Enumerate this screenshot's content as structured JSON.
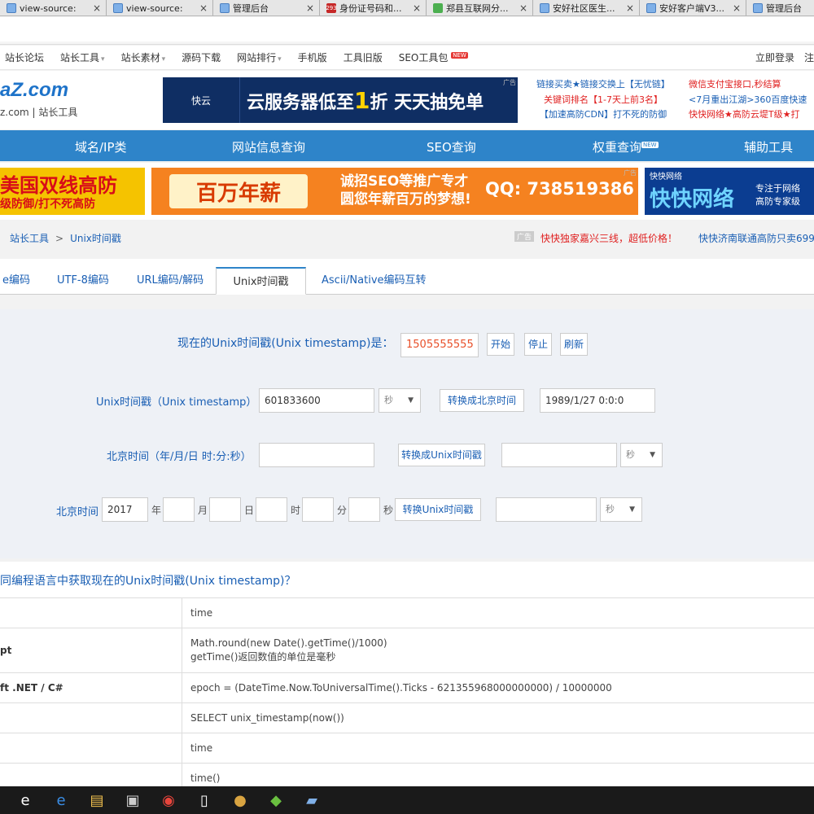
{
  "browser_tabs": [
    {
      "title": "view-source:",
      "favicon": "doc"
    },
    {
      "title": "view-source:",
      "favicon": "doc"
    },
    {
      "title": "管理后台",
      "favicon": "doc"
    },
    {
      "title": "身份证号码和...",
      "favicon": "red",
      "badge": "293"
    },
    {
      "title": "郑县互联网分...",
      "favicon": "grn"
    },
    {
      "title": "安好社区医生...",
      "favicon": "doc"
    },
    {
      "title": "安好客户端V3...",
      "favicon": "doc"
    },
    {
      "title": "管理后台",
      "favicon": "doc"
    }
  ],
  "topnav": {
    "items": [
      "站长论坛",
      "站长工具",
      "站长素材",
      "源码下载",
      "网站排行",
      "手机版",
      "工具旧版",
      "SEO工具包"
    ],
    "new_badge": "NEW",
    "login": "立即登录",
    "register": "注"
  },
  "logo": {
    "domain": ".com",
    "sub": "z.com | 站长工具"
  },
  "ad_top": {
    "brand": "快云",
    "brand_url": "kuaiyun.cn",
    "slogan_a": "云服务器低至",
    "slogan_num": "1",
    "slogan_b": "折 天天抽免单",
    "tag": "广告"
  },
  "text_ads": {
    "col1": [
      "链接买卖★链接交换上【无忧链】",
      "关键词排名【1-7天上前3名】",
      "【加速高防CDN】打不死的防御"
    ],
    "col2": [
      "微信支付宝接口,秒结算",
      "<7月重出江湖>360百度快速",
      "快快网络★高防云堤T级★打"
    ]
  },
  "mainnav": {
    "items": [
      "域名/IP类",
      "网站信息查询",
      "SEO查询",
      "权重查询",
      "辅助工具"
    ],
    "new_badge": "NEW"
  },
  "banners": {
    "b1_line1": "美国双线高防",
    "b1_line2": "级防御/打不死高防",
    "b2_money": "百万年薪",
    "b2_mid1": "诚招SEO等推广专才",
    "b2_mid2": "圆您年薪百万的梦想!",
    "b2_qq": "QQ: 738519386",
    "b3_brand": "快快网络",
    "b3_big": "快快网络",
    "b3_side1": "专注于网络",
    "b3_side2": "高防专家级",
    "tag": "广告"
  },
  "breadcrumb": {
    "root": "站长工具",
    "sep": ">",
    "current": "Unix时间戳",
    "ad_tag": "广告",
    "ad_a": "快快独家嘉兴三线，超低价格！",
    "ad_b": "快快济南联通高防只卖699"
  },
  "tool_tabs": [
    "e编码",
    "UTF-8编码",
    "URL编码/解码",
    "Unix时间戳",
    "Ascii/Native编码互转"
  ],
  "tool": {
    "now_label": "现在的Unix时间戳(Unix timestamp)是：",
    "now_value": "1505555555",
    "btn_start": "开始",
    "btn_stop": "停止",
    "btn_refresh": "刷新",
    "row1_label": "Unix时间戳（Unix timestamp）",
    "row1_input": "601833600",
    "row1_unit": "秒",
    "row1_btn": "转换成北京时间",
    "row1_output": "1989/1/27 0:0:0",
    "row2_label": "北京时间（年/月/日 时:分:秒）",
    "row2_input": "",
    "row2_btn": "转换成Unix时间戳",
    "row2_output": "",
    "row2_unit": "秒",
    "row3_label": "北京时间",
    "row3_year": "2017",
    "u_year": "年",
    "u_month": "月",
    "u_day": "日",
    "u_hour": "时",
    "u_min": "分",
    "u_sec": "秒",
    "row3_btn": "转换Unix时间戳",
    "row3_output": "",
    "row3_unit": "秒"
  },
  "question": "同编程语言中获取现在的Unix时间戳(Unix timestamp)？",
  "lang_rows": [
    {
      "lang": "",
      "code": [
        "time"
      ]
    },
    {
      "lang": "pt",
      "code": [
        "Math.round(new Date().getTime()/1000)",
        "getTime()返回数值的单位是毫秒"
      ]
    },
    {
      "lang": "ft .NET / C#",
      "code": [
        "epoch = (DateTime.Now.ToUniversalTime().Ticks - 621355968000000000) / 10000000"
      ]
    },
    {
      "lang": "",
      "code": [
        "SELECT unix_timestamp(now())"
      ]
    },
    {
      "lang": "",
      "code": [
        "time"
      ]
    },
    {
      "lang": "",
      "code": [
        "time()"
      ]
    }
  ],
  "taskbar_icons": [
    "ie-legacy-icon",
    "edge-icon",
    "file-explorer-icon",
    "media-icon",
    "chrome-icon",
    "notepad-icon",
    "bear-app-icon",
    "git-icon",
    "book-icon"
  ]
}
